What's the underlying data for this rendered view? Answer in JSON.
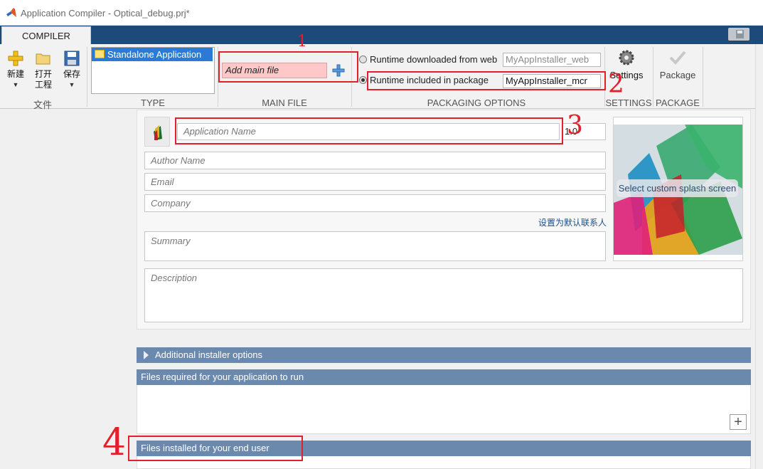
{
  "window": {
    "title": "Application Compiler - Optical_debug.prj*"
  },
  "tabs": [
    {
      "label": "COMPILER"
    }
  ],
  "toolstrip": {
    "file_group": {
      "label": "文件",
      "new_label": "新建",
      "open_label_1": "打开",
      "open_label_2": "工程",
      "save_label": "保存"
    },
    "type_group": {
      "label": "TYPE",
      "selected": "Standalone Application"
    },
    "main_file_group": {
      "label": "MAIN FILE",
      "placeholder": "Add main file"
    },
    "packaging_group": {
      "label": "PACKAGING OPTIONS",
      "runtime_web_label": "Runtime downloaded from web",
      "runtime_web_value": "MyAppInstaller_web",
      "runtime_pkg_label": "Runtime included in package",
      "runtime_pkg_value": "MyAppInstaller_mcr",
      "selected": "runtime_included"
    },
    "settings_group": {
      "label": "SETTINGS",
      "button": "Settings"
    },
    "package_group": {
      "label": "PACKAGE",
      "button": "Package"
    }
  },
  "form": {
    "app_name_placeholder": "Application Name",
    "version": "1.0",
    "author_placeholder": "Author Name",
    "email_placeholder": "Email",
    "company_placeholder": "Company",
    "set_default_contact": "设置为默认联系人",
    "summary_placeholder": "Summary",
    "description_placeholder": "Description",
    "splash_button": "Select custom splash screen"
  },
  "sections": {
    "additional_options": "Additional installer options",
    "files_required": "Files required for your application to run",
    "files_installed": "Files installed for your end user"
  },
  "annotations": {
    "n1": "1",
    "n2": "2",
    "n3": "3",
    "n4": "4"
  },
  "icons": [
    "matlab-logo-icon",
    "new-icon",
    "open-folder-icon",
    "save-icon",
    "application-icon",
    "add-icon",
    "gear-icon",
    "checkmark-icon",
    "expand-arrow-icon",
    "plus-icon"
  ],
  "colors": {
    "tab_strip": "#1d4a78",
    "selection": "#2b7bd6",
    "section_bar": "#6b88ad",
    "annotation": "#e0202a",
    "main_file_bg": "#ffc8c8"
  }
}
